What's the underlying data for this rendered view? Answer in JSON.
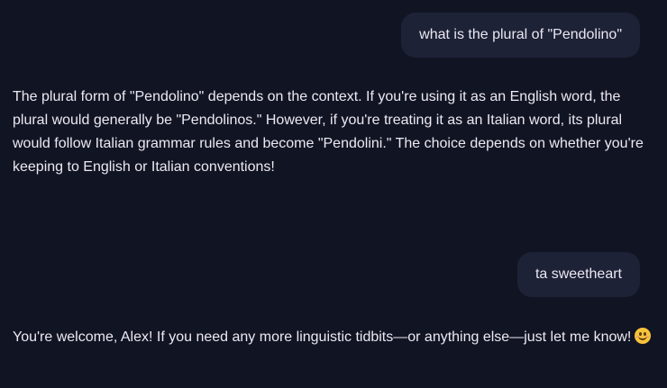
{
  "conversation": {
    "messages": [
      {
        "role": "user",
        "text": "what is the plural of \"Pendolino\""
      },
      {
        "role": "assistant",
        "text": "The plural form of \"Pendolino\" depends on the context. If you're using it as an English word, the plural would generally be \"Pendolinos.\" However, if you're treating it as an Italian word, its plural would follow Italian grammar rules and become \"Pendolini.\" The choice depends on whether you're keeping to English or Italian conventions!"
      },
      {
        "role": "user",
        "text": "ta sweetheart"
      },
      {
        "role": "assistant",
        "text": "You're welcome, Alex! If you need any more linguistic tidbits—or anything else—just let me know!",
        "emoji": "smiling-face-icon"
      }
    ]
  },
  "colors": {
    "background": "#111523",
    "user_bubble": "#1e2236",
    "text": "#ece9f3"
  }
}
